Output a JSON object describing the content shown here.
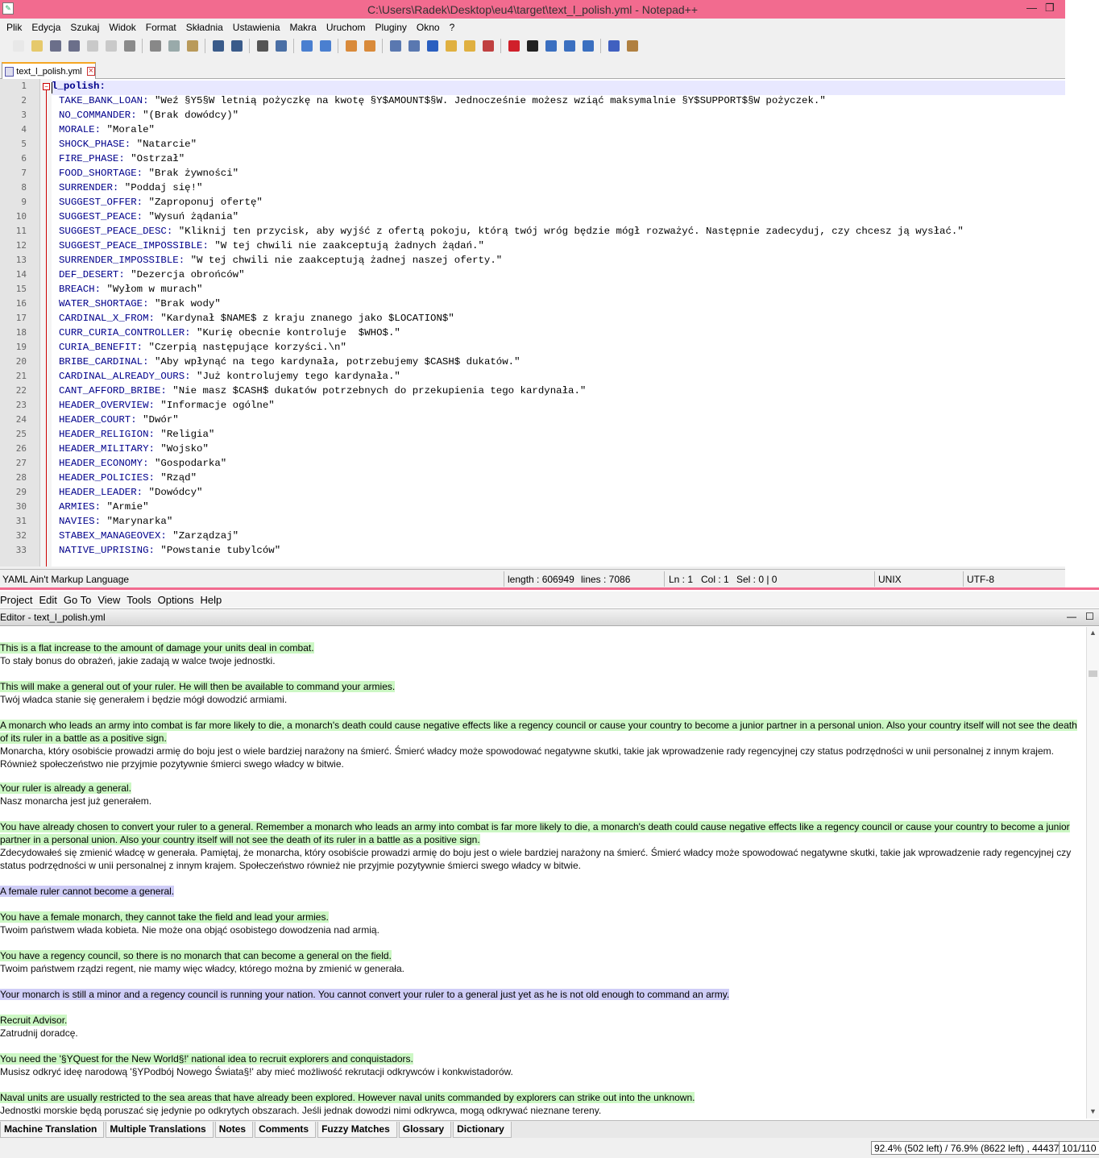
{
  "npp": {
    "title": "C:\\Users\\Radek\\Desktop\\eu4\\target\\text_l_polish.yml - Notepad++",
    "menu": [
      "Plik",
      "Edycja",
      "Szukaj",
      "Widok",
      "Format",
      "Składnia",
      "Ustawienia",
      "Makra",
      "Uruchom",
      "Pluginy",
      "Okno",
      "?"
    ],
    "tab": "text_l_polish.yml",
    "lines": [
      {
        "n": "1",
        "k": "l_polish:",
        "v": ""
      },
      {
        "n": "2",
        "k": "TAKE_BANK_LOAN:",
        "v": " \"Weź §Y5§W letnią pożyczkę na kwotę §Y$AMOUNT$§W. Jednocześnie możesz wziąć maksymalnie §Y$SUPPORT$§W pożyczek.\""
      },
      {
        "n": "3",
        "k": "NO_COMMANDER:",
        "v": " \"(Brak dowódcy)\""
      },
      {
        "n": "4",
        "k": "MORALE:",
        "v": " \"Morale\""
      },
      {
        "n": "5",
        "k": "SHOCK_PHASE:",
        "v": " \"Natarcie\""
      },
      {
        "n": "6",
        "k": "FIRE_PHASE:",
        "v": " \"Ostrzał\""
      },
      {
        "n": "7",
        "k": "FOOD_SHORTAGE:",
        "v": " \"Brak żywności\""
      },
      {
        "n": "8",
        "k": "SURRENDER:",
        "v": " \"Poddaj się!\""
      },
      {
        "n": "9",
        "k": "SUGGEST_OFFER:",
        "v": " \"Zaproponuj ofertę\""
      },
      {
        "n": "10",
        "k": "SUGGEST_PEACE:",
        "v": " \"Wysuń żądania\""
      },
      {
        "n": "11",
        "k": "SUGGEST_PEACE_DESC:",
        "v": " \"Kliknij ten przycisk, aby wyjść z ofertą pokoju, którą twój wróg będzie mógł rozważyć. Następnie zadecyduj, czy chcesz ją wysłać.\""
      },
      {
        "n": "12",
        "k": "SUGGEST_PEACE_IMPOSSIBLE:",
        "v": " \"W tej chwili nie zaakceptują żadnych żądań.\""
      },
      {
        "n": "13",
        "k": "SURRENDER_IMPOSSIBLE:",
        "v": " \"W tej chwili nie zaakceptują żadnej naszej oferty.\""
      },
      {
        "n": "14",
        "k": "DEF_DESERT:",
        "v": " \"Dezercja obrońców\""
      },
      {
        "n": "15",
        "k": "BREACH:",
        "v": " \"Wyłom w murach\""
      },
      {
        "n": "16",
        "k": "WATER_SHORTAGE:",
        "v": " \"Brak wody\""
      },
      {
        "n": "17",
        "k": "CARDINAL_X_FROM:",
        "v": " \"Kardynał $NAME$ z kraju znanego jako $LOCATION$\""
      },
      {
        "n": "18",
        "k": "CURR_CURIA_CONTROLLER:",
        "v": " \"Kurię obecnie kontroluje  $WHO$.\""
      },
      {
        "n": "19",
        "k": "CURIA_BENEFIT:",
        "v": " \"Czerpią następujące korzyści.\\n\""
      },
      {
        "n": "20",
        "k": "BRIBE_CARDINAL:",
        "v": " \"Aby wpłynąć na tego kardynała, potrzebujemy $CASH$ dukatów.\""
      },
      {
        "n": "21",
        "k": "CARDINAL_ALREADY_OURS:",
        "v": " \"Już kontrolujemy tego kardynała.\""
      },
      {
        "n": "22",
        "k": "CANT_AFFORD_BRIBE:",
        "v": " \"Nie masz $CASH$ dukatów potrzebnych do przekupienia tego kardynała.\""
      },
      {
        "n": "23",
        "k": "HEADER_OVERVIEW:",
        "v": " \"Informacje ogólne\""
      },
      {
        "n": "24",
        "k": "HEADER_COURT:",
        "v": " \"Dwór\""
      },
      {
        "n": "25",
        "k": "HEADER_RELIGION:",
        "v": " \"Religia\""
      },
      {
        "n": "26",
        "k": "HEADER_MILITARY:",
        "v": " \"Wojsko\""
      },
      {
        "n": "27",
        "k": "HEADER_ECONOMY:",
        "v": " \"Gospodarka\""
      },
      {
        "n": "28",
        "k": "HEADER_POLICIES:",
        "v": " \"Rząd\""
      },
      {
        "n": "29",
        "k": "HEADER_LEADER:",
        "v": " \"Dowódcy\""
      },
      {
        "n": "30",
        "k": "ARMIES:",
        "v": " \"Armie\""
      },
      {
        "n": "31",
        "k": "NAVIES:",
        "v": " \"Marynarka\""
      },
      {
        "n": "32",
        "k": "STABEX_MANAGEOVEX:",
        "v": " \"Zarządzaj\""
      },
      {
        "n": "33",
        "k": "NATIVE_UPRISING:",
        "v": " \"Powstanie tubylców\""
      }
    ],
    "status": {
      "lang": "YAML Ain't Markup Language",
      "length": "length : 606949",
      "lines": "lines : 7086",
      "ln": "Ln : 1",
      "col": "Col : 1",
      "sel": "Sel : 0 | 0",
      "eol": "UNIX",
      "enc": "UTF-8"
    }
  },
  "omt": {
    "menu": [
      "Project",
      "Edit",
      "Go To",
      "View",
      "Tools",
      "Options",
      "Help"
    ],
    "editor_title": "Editor - text_l_polish.yml",
    "segments": [
      {
        "src": "This is a flat increase to the amount of damage your units deal in combat.",
        "trg": "To stały bonus do obrażeń, jakie zadają w walce twoje jednostki.",
        "blue": false
      },
      {
        "src": "This will make a general out of your ruler. He will then be available to command your armies.",
        "trg": "Twój władca stanie się generałem i będzie mógł dowodzić armiami.",
        "blue": false
      },
      {
        "src": "A monarch who leads an army into combat is far more likely to die, a monarch's death could cause negative effects like a regency council or cause your country to become a junior partner in a personal union. Also your country itself will not see the death of its ruler in a battle as a positive sign.",
        "trg": "Monarcha, który osobiście prowadzi armię do boju jest o wiele bardziej narażony na śmierć. Śmierć władcy może spowodować negatywne skutki, takie jak wprowadzenie rady regencyjnej czy status podrzędności w unii personalnej z innym krajem. Również społeczeństwo nie przyjmie pozytywnie śmierci swego władcy w bitwie.",
        "blue": false
      },
      {
        "src": "Your ruler is already a general.",
        "trg": "Nasz monarcha jest już generałem.",
        "blue": false
      },
      {
        "src": "You have already chosen to convert your ruler to a general. Remember a monarch who leads an army into combat is far more likely to die, a monarch's death could cause negative effects like a regency council or cause your country to become a junior partner in a personal union. Also your country itself will not see the death of its ruler in a battle as a positive sign.",
        "trg": "Zdecydowałeś się zmienić władcę w generała. Pamiętaj, że monarcha, który osobiście prowadzi armię do boju jest o wiele bardziej narażony na śmierć. Śmierć władcy może spowodować negatywne skutki, takie jak wprowadzenie rady regencyjnej czy status podrzędności w unii personalnej z innym krajem. Społeczeństwo również nie przyjmie pozytywnie śmierci swego władcy w bitwie.",
        "blue": false
      },
      {
        "src": "A female ruler cannot become a general.",
        "trg": "",
        "blue": true
      },
      {
        "src": "You have a female monarch, they cannot take the field and lead your armies.",
        "trg": "Twoim państwem włada kobieta. Nie może ona objąć osobistego dowodzenia nad armią.",
        "blue": false
      },
      {
        "src": "You have a regency council, so there is no monarch that can become a general on the field.",
        "trg": "Twoim państwem rządzi regent, nie mamy więc władcy, którego można by zmienić w generała.",
        "blue": false
      },
      {
        "src": "Your monarch is still a minor and a regency council is running your nation. You cannot convert your ruler to a general just yet as he is not old enough to command an army.",
        "trg": "",
        "blue": true
      },
      {
        "src": "Recruit Advisor.",
        "trg": "Zatrudnij doradcę.",
        "blue": false
      },
      {
        "src": "You need the '§YQuest for the New World§!' national idea to recruit explorers and conquistadors.",
        "trg": "Musisz odkryć ideę narodową '§YPodbój Nowego Świata§!' aby mieć możliwość rekrutacji odkrywców i konkwistadorów.",
        "blue": false
      },
      {
        "src": "Naval units are usually restricted to the sea areas that have already been explored. However naval units commanded by explorers can strike out into the unknown.",
        "trg": "Jednostki morskie będą poruszać się jedynie po odkrytych obszarach. Jeśli jednak dowodzi nimi odkrywca, mogą odkrywać nieznane tereny.",
        "blue": false
      }
    ],
    "bottom_tabs": [
      "Machine Translation",
      "Multiple Translations",
      "Notes",
      "Comments",
      "Fuzzy Matches",
      "Glossary",
      "Dictionary"
    ],
    "progress": "92.4% (502 left) / 76.9% (8622 left) , 44437",
    "segment_pos": "101/110"
  },
  "colors": {
    "titlebar": "#f26b8f",
    "source_bg": "#ccf7c4",
    "untranslated_bg": "#cfcdf7"
  }
}
